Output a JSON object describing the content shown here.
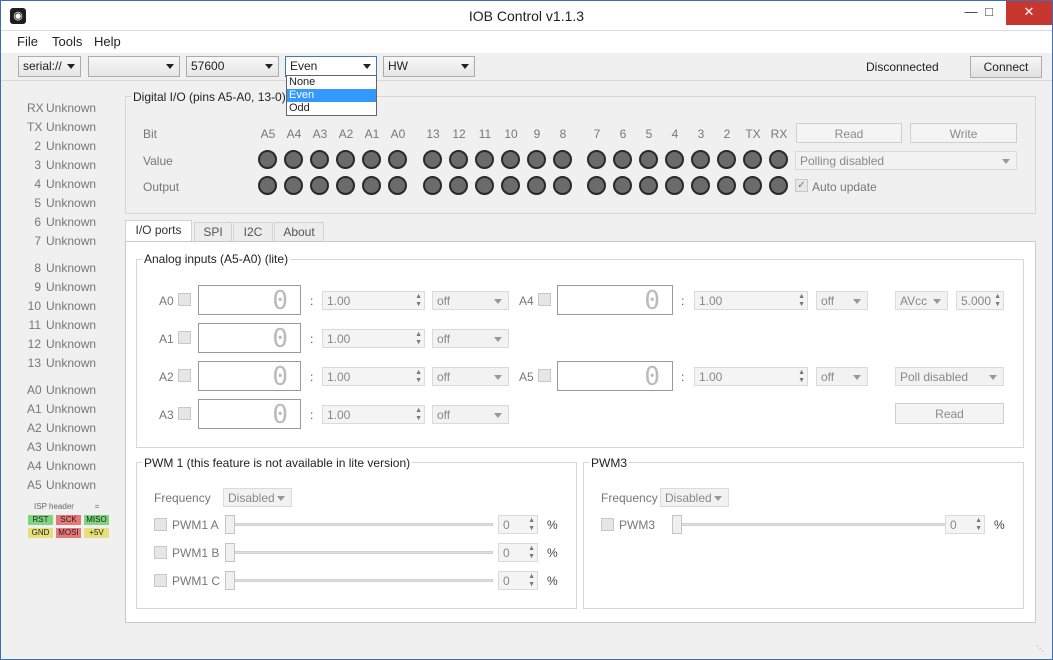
{
  "window": {
    "title": "IOB Control v1.1.3",
    "min": "—",
    "max": "□",
    "close": "✕"
  },
  "menu": {
    "file": "File",
    "tools": "Tools",
    "help": "Help"
  },
  "toolbar": {
    "port_type": "serial://",
    "port": "",
    "baud": "57600",
    "parity": "Even",
    "flow": "HW",
    "status": "Disconnected",
    "connect_label": "Connect"
  },
  "parity_options": [
    "None",
    "Even",
    "Odd"
  ],
  "sidebar": {
    "pins": [
      {
        "name": "RX",
        "value": "Unknown"
      },
      {
        "name": "TX",
        "value": "Unknown"
      },
      {
        "name": "2",
        "value": "Unknown"
      },
      {
        "name": "3",
        "value": "Unknown"
      },
      {
        "name": "4",
        "value": "Unknown"
      },
      {
        "name": "5",
        "value": "Unknown"
      },
      {
        "name": "6",
        "value": "Unknown"
      },
      {
        "name": "7",
        "value": "Unknown"
      },
      {
        "name": "8",
        "value": "Unknown"
      },
      {
        "name": "9",
        "value": "Unknown"
      },
      {
        "name": "10",
        "value": "Unknown"
      },
      {
        "name": "11",
        "value": "Unknown"
      },
      {
        "name": "12",
        "value": "Unknown"
      },
      {
        "name": "13",
        "value": "Unknown"
      },
      {
        "name": "A0",
        "value": "Unknown"
      },
      {
        "name": "A1",
        "value": "Unknown"
      },
      {
        "name": "A2",
        "value": "Unknown"
      },
      {
        "name": "A3",
        "value": "Unknown"
      },
      {
        "name": "A4",
        "value": "Unknown"
      },
      {
        "name": "A5",
        "value": "Unknown"
      }
    ],
    "isp_header": "ISP header",
    "isp_pins": [
      "RST",
      "SCK",
      "MISO",
      "GND",
      "MOSI",
      "+5V"
    ]
  },
  "digital": {
    "title": "Digital I/O (pins A5-A0, 13-0)",
    "bit_label": "Bit",
    "value_label": "Value",
    "output_label": "Output",
    "bits": [
      "A5",
      "A4",
      "A3",
      "A2",
      "A1",
      "A0",
      "13",
      "12",
      "11",
      "10",
      "9",
      "8",
      "7",
      "6",
      "5",
      "4",
      "3",
      "2",
      "TX",
      "RX"
    ],
    "read_label": "Read",
    "write_label": "Write",
    "polling": "Polling disabled",
    "auto_update": "Auto update"
  },
  "tabs": [
    "I/O ports",
    "SPI",
    "I2C",
    "About"
  ],
  "analog": {
    "title": "Analog inputs (A5-A0) (lite)",
    "channels": [
      {
        "name": "A0",
        "reading": "0",
        "factor": "1.00",
        "mode": "off"
      },
      {
        "name": "A1",
        "reading": "0",
        "factor": "1.00",
        "mode": "off"
      },
      {
        "name": "A2",
        "reading": "0",
        "factor": "1.00",
        "mode": "off"
      },
      {
        "name": "A3",
        "reading": "0",
        "factor": "1.00",
        "mode": "off"
      },
      {
        "name": "A4",
        "reading": "0",
        "factor": "1.00",
        "mode": "off"
      },
      {
        "name": "A5",
        "reading": "0",
        "factor": "1.00",
        "mode": "off"
      }
    ],
    "ref": "AVcc",
    "ref_voltage": "5.000",
    "poll": "Poll disabled",
    "read_label": "Read",
    "colon": ":"
  },
  "pwm1": {
    "title": "PWM 1 (this feature is not available in lite version)",
    "freq_label": "Frequency",
    "freq": "Disabled",
    "channels": [
      {
        "name": "PWM1 A",
        "value": "0"
      },
      {
        "name": "PWM1 B",
        "value": "0"
      },
      {
        "name": "PWM1 C",
        "value": "0"
      }
    ],
    "unit": "%"
  },
  "pwm3": {
    "title": "PWM3",
    "freq_label": "Frequency",
    "freq": "Disabled",
    "channels": [
      {
        "name": "PWM3",
        "value": "0"
      }
    ],
    "unit": "%"
  }
}
